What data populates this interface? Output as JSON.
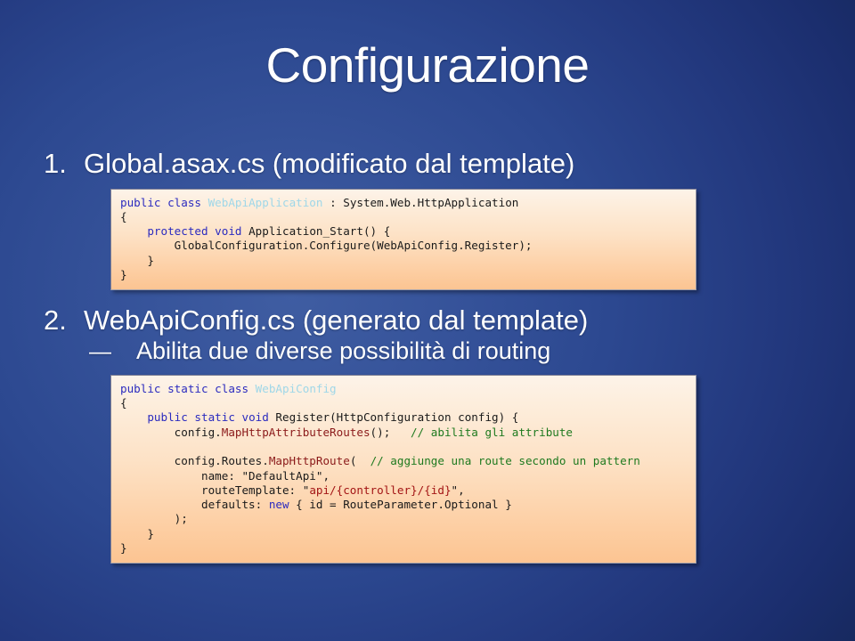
{
  "slide": {
    "title": "Configurazione",
    "background_color": "#2c4890",
    "title_color": "#ffffff"
  },
  "items": [
    {
      "marker": "1.",
      "text": "Global.asax.cs (modificato dal template)"
    },
    {
      "marker": "2.",
      "text": "WebApiConfig.cs (generato dal template)"
    }
  ],
  "subitem": {
    "marker": "—",
    "text": "Abilita due diverse possibilità di routing"
  },
  "code_blocks": [
    {
      "name": "global-asax-code",
      "lines": [
        [
          {
            "t": "public class ",
            "c": "kw"
          },
          {
            "t": "WebApiApplication",
            "c": "typ"
          },
          {
            "t": " : System.Web.HttpApplication",
            "c": "pl"
          }
        ],
        [
          {
            "t": "{",
            "c": "pl"
          }
        ],
        [
          {
            "t": "    ",
            "c": "pl"
          },
          {
            "t": "protected void ",
            "c": "kw"
          },
          {
            "t": "Application_Start() {",
            "c": "pl"
          }
        ],
        [
          {
            "t": "        GlobalConfiguration.Configure(WebApiConfig.Register);",
            "c": "pl"
          }
        ],
        [
          {
            "t": "    }",
            "c": "pl"
          }
        ],
        [
          {
            "t": "}",
            "c": "pl"
          }
        ]
      ]
    },
    {
      "name": "webapiconfig-code",
      "lines": [
        [
          {
            "t": "public static class ",
            "c": "kw"
          },
          {
            "t": "WebApiConfig",
            "c": "typ"
          }
        ],
        [
          {
            "t": "{",
            "c": "pl"
          }
        ],
        [
          {
            "t": "    ",
            "c": "pl"
          },
          {
            "t": "public static void ",
            "c": "kw"
          },
          {
            "t": "Register(HttpConfiguration config) {",
            "c": "pl"
          }
        ],
        [
          {
            "t": "        config.",
            "c": "pl"
          },
          {
            "t": "MapHttpAttributeRoutes",
            "c": "mth"
          },
          {
            "t": "();   ",
            "c": "pl"
          },
          {
            "t": "// abilita gli attribute",
            "c": "cmt"
          }
        ],
        [
          {
            "t": "",
            "c": "pl"
          }
        ],
        [
          {
            "t": "        config.Routes.",
            "c": "pl"
          },
          {
            "t": "MapHttpRoute",
            "c": "mth"
          },
          {
            "t": "(  ",
            "c": "pl"
          },
          {
            "t": "// aggiunge una route secondo un pattern",
            "c": "cmt"
          }
        ],
        [
          {
            "t": "            name: \"DefaultApi\",",
            "c": "pl"
          }
        ],
        [
          {
            "t": "            routeTemplate: \"",
            "c": "pl"
          },
          {
            "t": "api/{controller}/{id}",
            "c": "str"
          },
          {
            "t": "\",",
            "c": "pl"
          }
        ],
        [
          {
            "t": "            defaults: ",
            "c": "pl"
          },
          {
            "t": "new",
            "c": "kw"
          },
          {
            "t": " { id = RouteParameter.Optional }",
            "c": "pl"
          }
        ],
        [
          {
            "t": "        );",
            "c": "pl"
          }
        ],
        [
          {
            "t": "    }",
            "c": "pl"
          }
        ],
        [
          {
            "t": "}",
            "c": "pl"
          }
        ]
      ]
    }
  ]
}
